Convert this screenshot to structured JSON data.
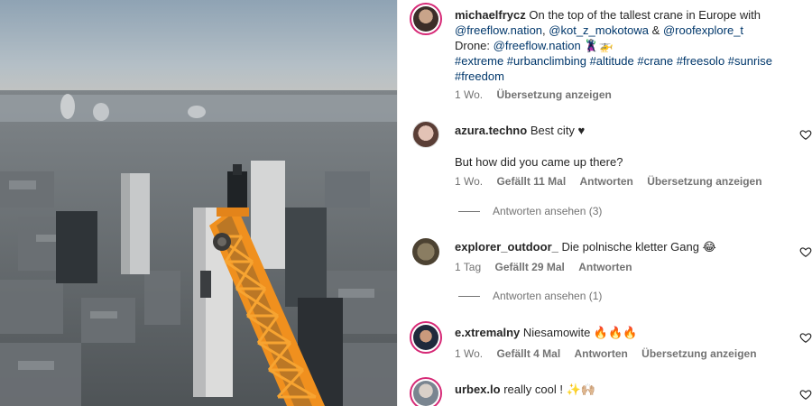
{
  "post": {
    "username": "michaelfrycz",
    "caption_line1": "On the top of the tallest crane in Europe with",
    "mentions": [
      "@freeflow.nation",
      "@kot_z_mokotowa",
      "@roofexplore_t"
    ],
    "mention_sep_1": ",",
    "mention_sep_2": "&",
    "drone_label": "Drone:",
    "drone_mention": "@freeflow.nation",
    "emoji": "🦹‍♂️🚁",
    "hashtags_line1": "#extreme #urbanclimbing #altitude #crane #freesolo #sunrise",
    "hashtags_line2": "#freedom",
    "time": "1 Wo.",
    "translate": "Übersetzung anzeigen"
  },
  "comments": [
    {
      "username": "azura.techno",
      "text": "Best city ♥",
      "text2": "But how did you came up there?",
      "time": "1 Wo.",
      "likes": "Gefällt 11 Mal",
      "reply": "Antworten",
      "translate": "Übersetzung anzeigen",
      "view_replies": "Antworten ansehen (3)"
    },
    {
      "username": "explorer_outdoor_",
      "text": "Die polnische kletter Gang 😂",
      "time": "1 Tag",
      "likes": "Gefällt 29 Mal",
      "reply": "Antworten",
      "view_replies": "Antworten ansehen (1)"
    },
    {
      "username": "e.xtremalny",
      "text": "Niesamowite 🔥🔥🔥",
      "time": "1 Wo.",
      "likes": "Gefällt 4 Mal",
      "reply": "Antworten",
      "translate": "Übersetzung anzeigen"
    },
    {
      "username": "urbex.lo",
      "text": "really cool ! ✨🙌🏼"
    }
  ],
  "icons": {
    "heart": "heart-outline-icon"
  }
}
